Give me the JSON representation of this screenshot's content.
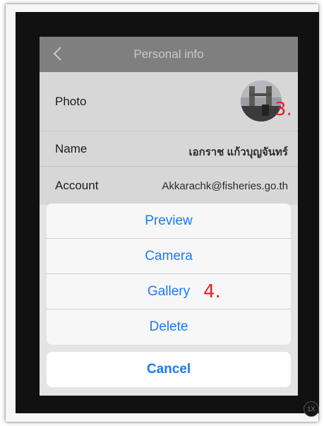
{
  "nav": {
    "title": "Personal info",
    "back_icon": "chevron-left-icon"
  },
  "rows": {
    "photo_label": "Photo",
    "name_label": "Name",
    "name_value": "เอกราช แก้วบุญจันทร์",
    "account_label": "Account",
    "account_value": "Akkarachk@fisheries.go.th"
  },
  "annotations": {
    "step3": "3.",
    "step4": "4."
  },
  "action_sheet": {
    "items": [
      {
        "label": "Preview"
      },
      {
        "label": "Camera"
      },
      {
        "label": "Gallery"
      },
      {
        "label": "Delete"
      }
    ],
    "cancel_label": "Cancel"
  },
  "zoom_badge": "1X",
  "colors": {
    "accent": "#1f7ae6",
    "annotation": "#e0262b",
    "navbar": "#7f7f7f"
  }
}
